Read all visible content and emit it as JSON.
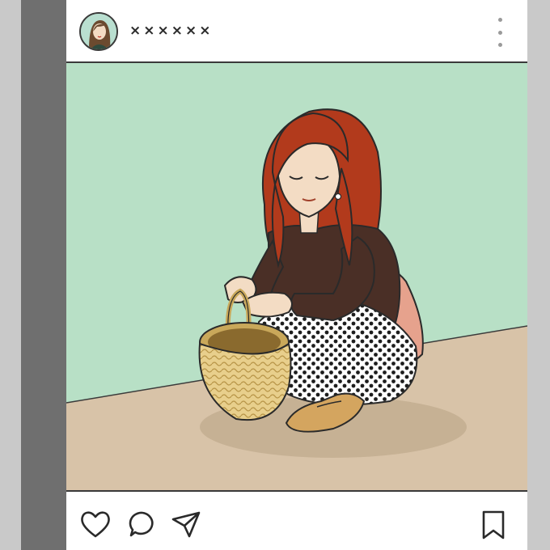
{
  "post": {
    "username": "××××××",
    "colors": {
      "wall": "#b8e0c6",
      "floor": "#d8c3a8",
      "frame": "#6f6f6f",
      "hair": "#b23a1c",
      "sweater": "#4a2f26",
      "bag": "#e6a28d"
    }
  },
  "icons": {
    "more": "more-vertical-icon",
    "like": "heart-icon",
    "comment": "comment-bubble-icon",
    "share": "paper-plane-icon",
    "save": "bookmark-icon"
  }
}
